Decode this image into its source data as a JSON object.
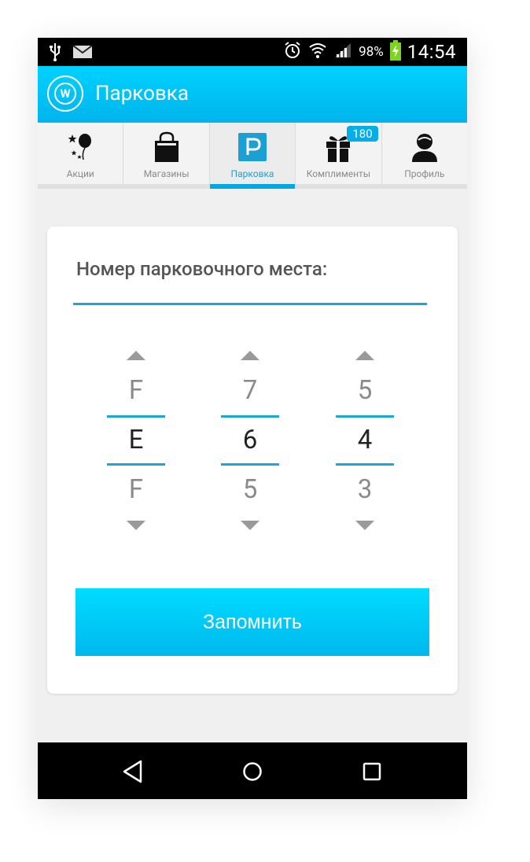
{
  "status_bar": {
    "battery_percent": "98%",
    "time": "14:54"
  },
  "app_bar": {
    "title": "Парковка",
    "logo_letter": "W"
  },
  "tabs": [
    {
      "label": "Акции",
      "icon": "balloons-icon",
      "active": false
    },
    {
      "label": "Магазины",
      "icon": "shopping-bag-icon",
      "active": false
    },
    {
      "label": "Парковка",
      "icon": "parking-icon",
      "active": true
    },
    {
      "label": "Комплименты",
      "icon": "gift-icon",
      "active": false,
      "badge": "180"
    },
    {
      "label": "Профиль",
      "icon": "profile-icon",
      "active": false
    }
  ],
  "parking_card": {
    "title": "Номер парковочного места:",
    "pickers": [
      {
        "prev": "F",
        "selected": "E",
        "next": "F"
      },
      {
        "prev": "7",
        "selected": "6",
        "next": "5"
      },
      {
        "prev": "5",
        "selected": "4",
        "next": "3"
      }
    ],
    "save_label": "Запомнить"
  },
  "colors": {
    "accent": "#00b4ec",
    "app_bar_top": "#00d2ff",
    "underline": "#1aa6d8",
    "status_bar": "#000000",
    "battery": "#7ed321"
  }
}
